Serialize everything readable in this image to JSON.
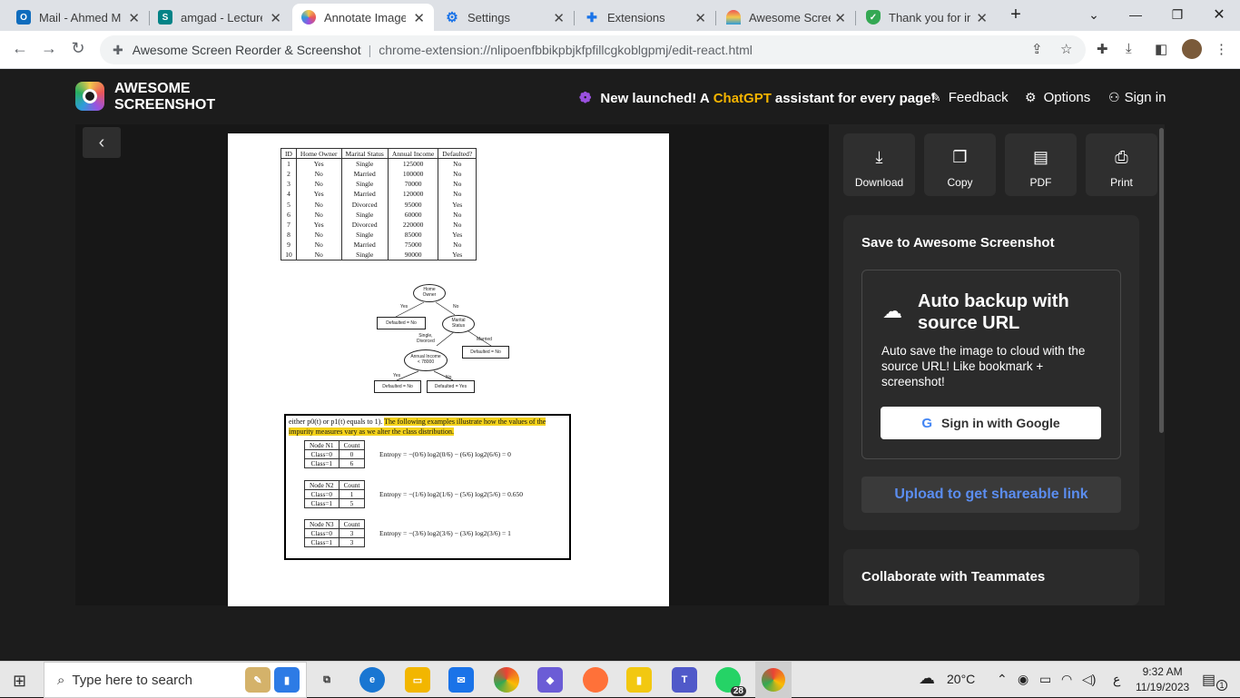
{
  "browser": {
    "tabs": [
      {
        "title": "Mail - Ahmed M",
        "icon": "outlook-icon",
        "color": "#0f6cbd"
      },
      {
        "title": "amgad - Lecture",
        "icon": "sharepoint-icon",
        "color": "#038387"
      },
      {
        "title": "Annotate Image",
        "icon": "awesome-screenshot-icon",
        "color": "#9b51e0",
        "active": true
      },
      {
        "title": "Settings",
        "icon": "gear-icon",
        "color": "#1a73e8"
      },
      {
        "title": "Extensions",
        "icon": "puzzle-icon",
        "color": "#1a73e8"
      },
      {
        "title": "Awesome Screer",
        "icon": "rainbow-icon",
        "color": "#e55"
      },
      {
        "title": "Thank you for in",
        "icon": "shield-check-icon",
        "color": "#34a853"
      }
    ],
    "new_tab": "+",
    "address": {
      "site": "Awesome Screen Reorder & Screenshot",
      "separator": "|",
      "url": "chrome-extension://nlipoenfbbikpbjkfpfillcgkoblgpmj/edit-react.html"
    }
  },
  "app": {
    "brand_line1": "AWESOME",
    "brand_line2": "SCREENSHOT",
    "promo_prefix": "New launched! A",
    "promo_gpt": "ChatGPT",
    "promo_suffix": "assistant for every page!",
    "feedback": "Feedback",
    "options": "Options",
    "sign_in": "Sign in"
  },
  "document": {
    "table_headers": [
      "ID",
      "Home Owner",
      "Marital Status",
      "Annual Income",
      "Defaulted?"
    ],
    "table_rows": [
      [
        "1",
        "Yes",
        "Single",
        "125000",
        "No"
      ],
      [
        "2",
        "No",
        "Married",
        "100000",
        "No"
      ],
      [
        "3",
        "No",
        "Single",
        "70000",
        "No"
      ],
      [
        "4",
        "Yes",
        "Married",
        "120000",
        "No"
      ],
      [
        "5",
        "No",
        "Divorced",
        "95000",
        "Yes"
      ],
      [
        "6",
        "No",
        "Single",
        "60000",
        "No"
      ],
      [
        "7",
        "Yes",
        "Divorced",
        "220000",
        "No"
      ],
      [
        "8",
        "No",
        "Single",
        "85000",
        "Yes"
      ],
      [
        "9",
        "No",
        "Married",
        "75000",
        "No"
      ],
      [
        "10",
        "No",
        "Single",
        "90000",
        "Yes"
      ]
    ],
    "tree": {
      "root_l1": "Home",
      "root_l2": "Owner",
      "yes": "Yes",
      "no": "No",
      "leaf1": "Defaulted = No",
      "ms_l1": "Marital",
      "ms_l2": "Status",
      "single_div_l1": "Single,",
      "single_div_l2": "Divorced",
      "married": "Married",
      "leaf2": "Defaulted = No",
      "ai_l1": "Annual Income",
      "ai_l2": "< 78000",
      "yes2": "Yes",
      "no2": "No",
      "leaf3": "Defaulted = No",
      "leaf4": "Defaulted = Yes"
    },
    "excerpt_plain": "either p0(t) or p1(t) equals to 1).",
    "excerpt_hl": "The following examples illustrate how the values of the impurity measures vary as we alter the class distribution.",
    "examples": [
      {
        "node": "Node N1",
        "count": "Count",
        "c0": "Class=0",
        "v0": "0",
        "c1": "Class=1",
        "v1": "6",
        "entropy": "Entropy = −(0/6) log2(0/6) − (6/6) log2(6/6) = 0"
      },
      {
        "node": "Node N2",
        "count": "Count",
        "c0": "Class=0",
        "v0": "1",
        "c1": "Class=1",
        "v1": "5",
        "entropy": "Entropy = −(1/6) log2(1/6) − (5/6) log2(5/6) = 0.650"
      },
      {
        "node": "Node N3",
        "count": "Count",
        "c0": "Class=0",
        "v0": "3",
        "c1": "Class=1",
        "v1": "3",
        "entropy": "Entropy = −(3/6) log2(3/6) − (3/6) log2(3/6) = 1"
      }
    ]
  },
  "panel": {
    "actions": [
      "Download",
      "Copy",
      "PDF",
      "Print"
    ],
    "save_title": "Save to Awesome Screenshot",
    "backup_title": "Auto backup with source URL",
    "backup_desc": "Auto save the image to cloud with the source URL! Like bookmark + screenshot!",
    "google_btn": "Sign in with Google",
    "upload_btn": "Upload to get shareable link",
    "collab_title": "Collaborate with Teammates"
  },
  "taskbar": {
    "search_placeholder": "Type here to search",
    "temperature": "20°C",
    "time": "9:32 AM",
    "date": "11/19/2023",
    "whatsapp_badge": "28",
    "notif_badge": "1",
    "lang": "ع"
  }
}
